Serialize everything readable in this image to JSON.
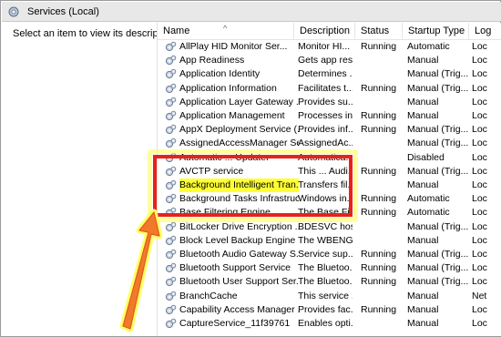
{
  "window": {
    "title": "Services (Local)"
  },
  "left_pane": {
    "description": "Select an item to view its description."
  },
  "columns": {
    "name": "Name",
    "description": "Description",
    "status": "Status",
    "startup_type": "Startup Type",
    "logon": "Log"
  },
  "rows": [
    {
      "name": "AllPlay HID Monitor Ser...",
      "desc": "Monitor HI...",
      "status": "Running",
      "startup": "Automatic",
      "logon": "Loc"
    },
    {
      "name": "App Readiness",
      "desc": "Gets app res...",
      "status": "",
      "startup": "Manual",
      "logon": "Loc"
    },
    {
      "name": "Application Identity",
      "desc": "Determines ...",
      "status": "",
      "startup": "Manual (Trig...",
      "logon": "Loc"
    },
    {
      "name": "Application Information",
      "desc": "Facilitates t...",
      "status": "Running",
      "startup": "Manual (Trig...",
      "logon": "Loc"
    },
    {
      "name": "Application Layer Gateway ...",
      "desc": "Provides su...",
      "status": "",
      "startup": "Manual",
      "logon": "Loc"
    },
    {
      "name": "Application Management",
      "desc": "Processes in...",
      "status": "Running",
      "startup": "Manual",
      "logon": "Loc"
    },
    {
      "name": "AppX Deployment Service (...",
      "desc": "Provides inf...",
      "status": "Running",
      "startup": "Manual (Trig...",
      "logon": "Loc"
    },
    {
      "name": "AssignedAccessManager Se...",
      "desc": "AssignedAc...",
      "status": "",
      "startup": "Manual (Trig...",
      "logon": "Loc"
    },
    {
      "name": "Automatic ... Updater",
      "desc": "Automatica...",
      "status": "",
      "startup": "Disabled",
      "logon": "Loc"
    },
    {
      "name": "AVCTP service",
      "desc": "This ... Audi...",
      "status": "Running",
      "startup": "Manual (Trig...",
      "logon": "Loc"
    },
    {
      "name": "Background Intelligent Tran...",
      "desc": "Transfers fil...",
      "status": "",
      "startup": "Manual",
      "logon": "Loc"
    },
    {
      "name": "Background Tasks Infrastruc...",
      "desc": "Windows in...",
      "status": "Running",
      "startup": "Automatic",
      "logon": "Loc"
    },
    {
      "name": "Base Filtering Engine",
      "desc": "The Base Fil...",
      "status": "Running",
      "startup": "Automatic",
      "logon": "Loc"
    },
    {
      "name": "BitLocker Drive Encryption ...",
      "desc": "BDESVC hos...",
      "status": "",
      "startup": "Manual (Trig...",
      "logon": "Loc"
    },
    {
      "name": "Block Level Backup Engine ...",
      "desc": "The WBENG...",
      "status": "",
      "startup": "Manual",
      "logon": "Loc"
    },
    {
      "name": "Bluetooth Audio Gateway S...",
      "desc": "Service sup...",
      "status": "Running",
      "startup": "Manual (Trig...",
      "logon": "Loc"
    },
    {
      "name": "Bluetooth Support Service",
      "desc": "The Bluetoo...",
      "status": "Running",
      "startup": "Manual (Trig...",
      "logon": "Loc"
    },
    {
      "name": "Bluetooth User Support Ser...",
      "desc": "The Bluetoo...",
      "status": "Running",
      "startup": "Manual (Trig...",
      "logon": "Loc"
    },
    {
      "name": "BranchCache",
      "desc": "This service ...",
      "status": "",
      "startup": "Manual",
      "logon": "Net"
    },
    {
      "name": "Capability Access Manager ...",
      "desc": "Provides fac...",
      "status": "Running",
      "startup": "Manual",
      "logon": "Loc"
    },
    {
      "name": "CaptureService_11f39761",
      "desc": "Enables opti...",
      "status": "",
      "startup": "Manual",
      "logon": "Loc"
    }
  ],
  "highlighted_row": 10,
  "colors": {
    "red_box": "#e8221b",
    "highlight": "#ffff33",
    "arrow_fill": "#f07a2a",
    "arrow_glow": "#ffff66"
  }
}
